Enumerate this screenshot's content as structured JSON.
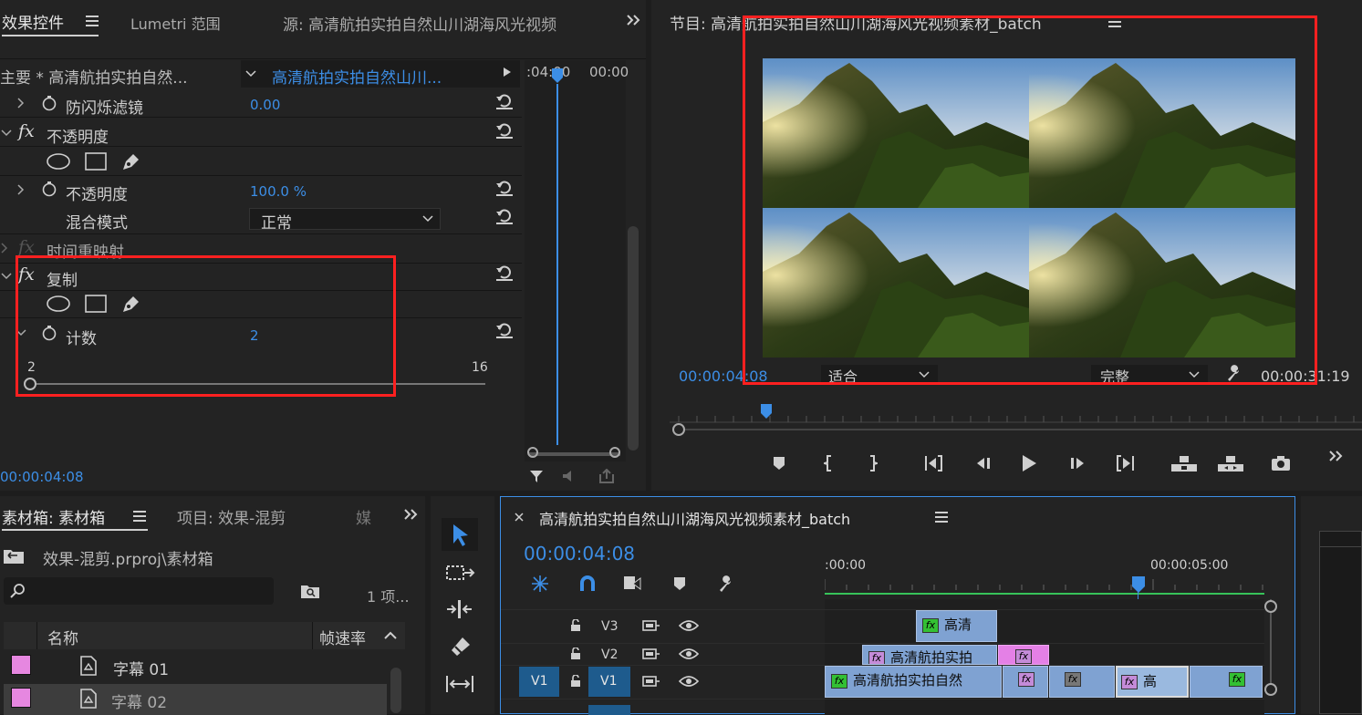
{
  "effect_controls": {
    "tab_effects": "效果控件",
    "tab_lumetri": "Lumetri 范围",
    "tab_source": "源: 高清航拍实拍自然山川湖海风光视频",
    "master_label": "主要 * 高清航拍实拍自然...",
    "clip_label": "高清航拍实拍自然山川...",
    "ruler_time_1": ":04:00",
    "ruler_time_2": "00:00",
    "anti_flicker_label": "防闪烁滤镜",
    "anti_flicker_value": "0.00",
    "opacity_section": "不透明度",
    "opacity_label": "不透明度",
    "opacity_value": "100.0 %",
    "blend_mode_label": "混合模式",
    "blend_mode_value": "正常",
    "time_remap": "时间重映射",
    "replicate_section": "复制",
    "count_label": "计数",
    "count_value": "2",
    "slider_min": "2",
    "slider_max": "16",
    "slider_position": 0,
    "current_time": "00:00:04:08",
    "fx_symbol": "fx"
  },
  "program_monitor": {
    "title": "节目: 高清航拍实拍自然山川湖海风光视频素材_batch",
    "current_time": "00:00:04:08",
    "fit_value": "适合",
    "quality_value": "完整",
    "duration": "00:00:31:19",
    "grid": "2x2"
  },
  "project_panel": {
    "tab_bin": "素材箱: 素材箱",
    "tab_project": "项目: 效果-混剪",
    "tab_more": "媒",
    "path": "效果-混剪.prproj\\素材箱",
    "items_count": "1 项...",
    "col_name": "名称",
    "col_fps": "帧速率",
    "items": [
      {
        "name": "字幕 01",
        "color": "#e687e0"
      },
      {
        "name": "字幕 02",
        "color": "#e687e0"
      }
    ]
  },
  "timeline": {
    "title": "高清航拍实拍自然山川湖海风光视频素材_batch",
    "current_time": "00:00:04:08",
    "ruler_start": ":00:00",
    "ruler_mark": "00:00:05:00",
    "tracks": [
      {
        "name": "V3"
      },
      {
        "name": "V2"
      },
      {
        "name": "V1",
        "source": "V1"
      }
    ],
    "clips": {
      "v3_clip1": "高清",
      "v2_clip1": "高清航拍实拍",
      "v1_clip1": "高清航拍实拍自然",
      "v1_clip4": "高"
    },
    "fx_symbol": "fx"
  },
  "colors": {
    "accent": "#3c8ee6",
    "highlight": "#ff2020",
    "clip": "#7fa2d2",
    "fx_green": "#33c033",
    "fx_purple": "#c48bd8"
  }
}
